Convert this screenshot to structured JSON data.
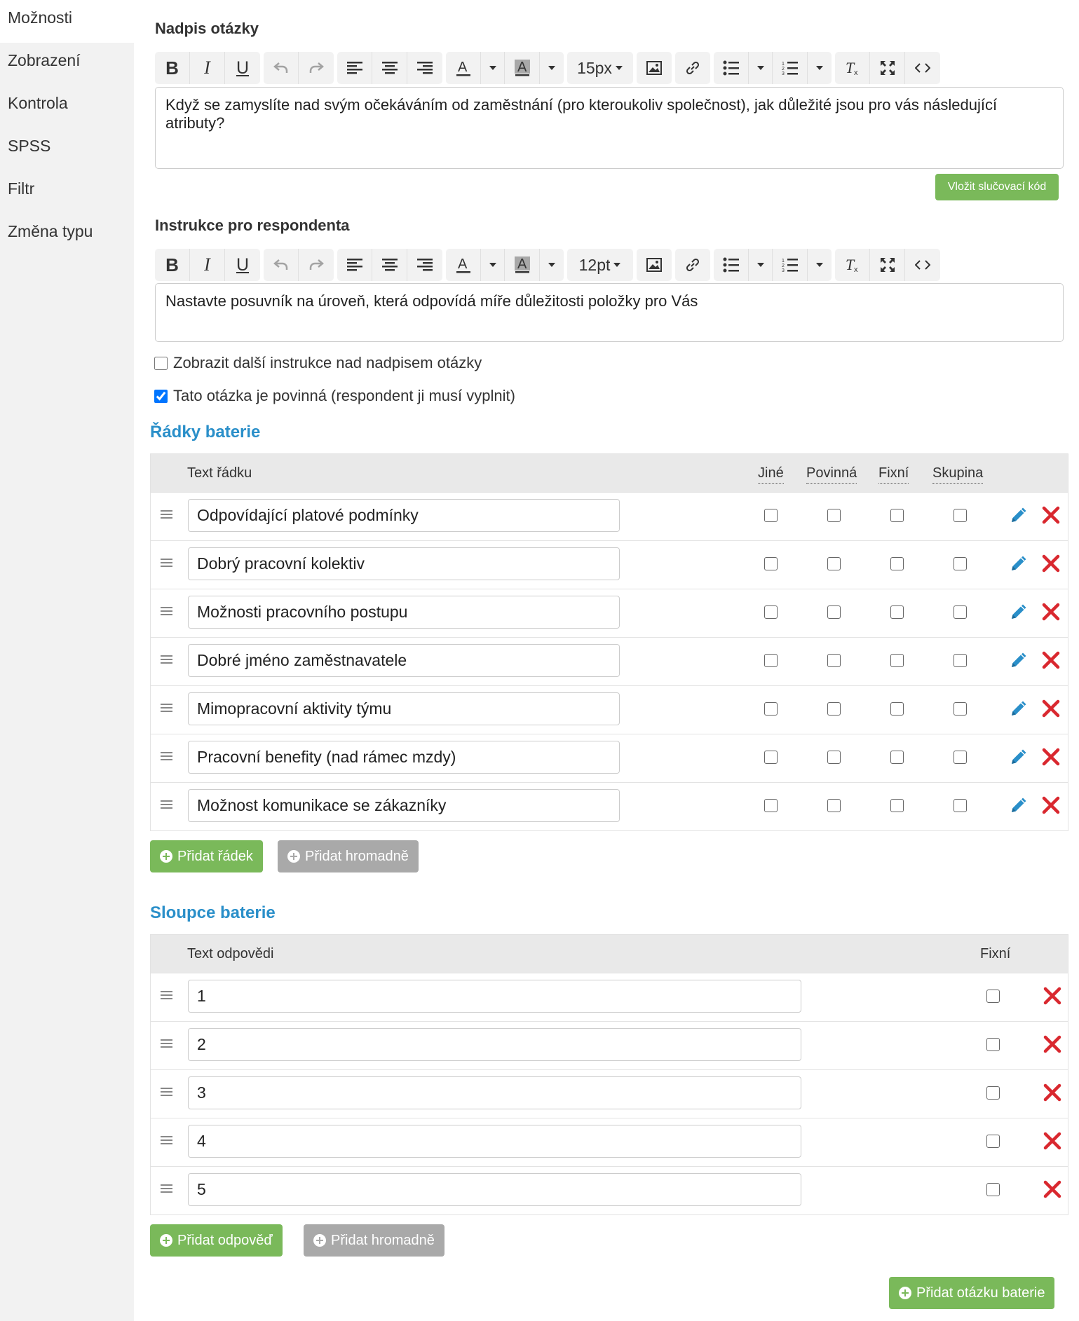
{
  "sidebar": {
    "items": [
      {
        "label": "Možnosti"
      },
      {
        "label": "Zobrazení"
      },
      {
        "label": "Kontrola"
      },
      {
        "label": "SPSS"
      },
      {
        "label": "Filtr"
      },
      {
        "label": "Změna typu"
      }
    ]
  },
  "question": {
    "title_label": "Nadpis otázky",
    "font_size": "15px",
    "text": "Když se zamyslíte nad svým očekáváním od zaměstnání (pro kteroukoliv společnost), jak důležité jsou pro vás následující atributy?",
    "merge_code_label": "Vložit slučovací kód"
  },
  "instructions": {
    "title_label": "Instrukce pro respondenta",
    "font_size": "12pt",
    "text": "Nastavte posuvník na úroveň, která odpovídá míře důležitosti položky pro Vás"
  },
  "options": {
    "show_extra_label": "Zobrazit další instrukce nad nadpisem otázky",
    "show_extra_checked": false,
    "required_label": "Tato otázka je povinná (respondent ji musí vyplnit)",
    "required_checked": true
  },
  "rows_section": {
    "title": "Řádky baterie",
    "headers": {
      "text": "Text řádku",
      "other": "Jiné",
      "required": "Povinná",
      "fixed": "Fixní",
      "group": "Skupina"
    },
    "rows": [
      {
        "text": "Odpovídající platové podmínky"
      },
      {
        "text": "Dobrý pracovní kolektiv"
      },
      {
        "text": "Možnosti pracovního postupu"
      },
      {
        "text": "Dobré jméno zaměstnavatele"
      },
      {
        "text": "Mimopracovní aktivity týmu"
      },
      {
        "text": "Pracovní benefity (nad rámec mzdy)"
      },
      {
        "text": "Možnost komunikace se zákazníky"
      }
    ],
    "add_label": "Přidat řádek",
    "bulk_label": "Přidat hromadně"
  },
  "columns_section": {
    "title": "Sloupce baterie",
    "headers": {
      "text": "Text odpovědi",
      "fixed": "Fixní"
    },
    "rows": [
      {
        "text": "1"
      },
      {
        "text": "2"
      },
      {
        "text": "3"
      },
      {
        "text": "4"
      },
      {
        "text": "5"
      }
    ],
    "add_label": "Přidat odpověď",
    "bulk_label": "Přidat hromadně"
  },
  "footer": {
    "add_battery_label": "Přidat otázku baterie"
  },
  "colors": {
    "accent_green": "#7ab95a",
    "accent_blue": "#2a8fc9",
    "delete_red": "#d9282f",
    "edit_blue": "#2a8fc9"
  }
}
